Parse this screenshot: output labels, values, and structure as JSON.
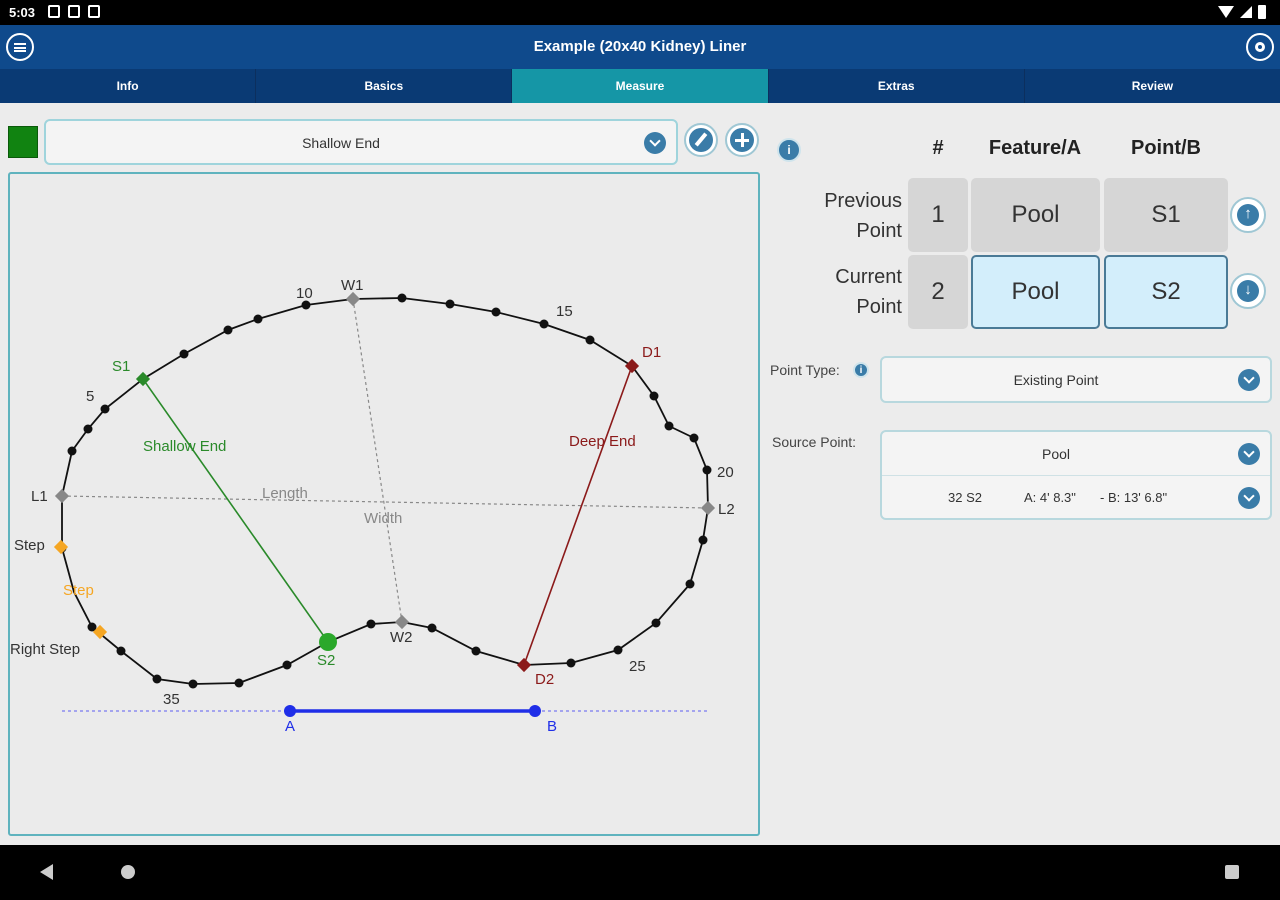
{
  "status": {
    "time": "5:03"
  },
  "app": {
    "title": "Example (20x40 Kidney) Liner"
  },
  "tabs": [
    {
      "label": "Info"
    },
    {
      "label": "Basics"
    },
    {
      "label": "Measure"
    },
    {
      "label": "Extras"
    },
    {
      "label": "Review"
    }
  ],
  "active_tab": "Measure",
  "feature": {
    "selected": "Shallow End",
    "color": "#118311"
  },
  "diagram": {
    "labels": {
      "s1": "S1",
      "s2": "S2",
      "d1": "D1",
      "d2": "D2",
      "w1": "W1",
      "w2": "W2",
      "l1": "L1",
      "l2": "L2",
      "shallow_end": "Shallow End",
      "deep_end": "Deep End",
      "length": "Length",
      "width": "Width",
      "step1": "Step",
      "step2": "Step",
      "step3": "Right Step",
      "n5": "5",
      "n10": "10",
      "n15": "15",
      "n20": "20",
      "n25": "25",
      "n35": "35",
      "a": "A",
      "b": "B"
    },
    "colors": {
      "shallow": "#2a8a2a",
      "deep": "#8b1a1a",
      "step": "#f5a623",
      "guide": "#1f2ee8",
      "ref": "#888888"
    }
  },
  "table": {
    "headers": {
      "num": "#",
      "feature": "Feature/A",
      "point": "Point/B"
    },
    "previous": {
      "label_line1": "Previous",
      "label_line2": "Point",
      "num": "1",
      "feature": "Pool",
      "point": "S1"
    },
    "current": {
      "label_line1": "Current",
      "label_line2": "Point",
      "num": "2",
      "feature": "Pool",
      "point": "S2"
    }
  },
  "point_type": {
    "label": "Point Type:",
    "value": "Existing Point"
  },
  "source_point": {
    "label": "Source Point:",
    "value": "Pool",
    "detail_id": "32 S2",
    "detail_a": "A: 4' 8.3\"",
    "detail_b": "- B: 13' 6.8\""
  }
}
